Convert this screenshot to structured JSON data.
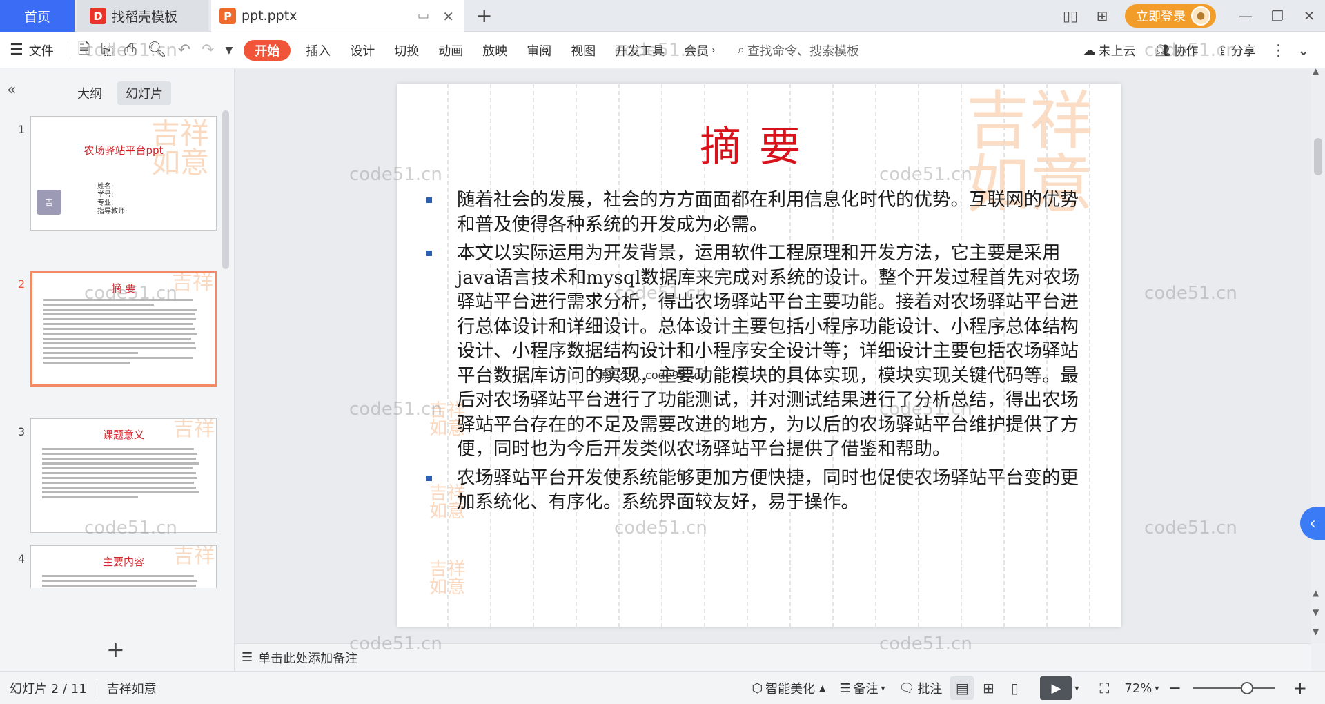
{
  "titlebar": {
    "home_tab": "首页",
    "template_tab": "找稻壳模板",
    "file_tab": "ppt.pptx",
    "login_button": "立即登录"
  },
  "ribbon": {
    "file_menu": "文件",
    "tabs": [
      "开始",
      "插入",
      "设计",
      "切换",
      "动画",
      "放映",
      "审阅",
      "视图",
      "开发工具",
      "会员"
    ],
    "search_placeholder": "查找命令、搜索模板",
    "cloud_status": "未上云",
    "collab": "协作",
    "share": "分享"
  },
  "left_panel": {
    "tab_outline": "大纲",
    "tab_slides": "幻灯片",
    "thumbs": [
      {
        "num": "1",
        "title": "农场驿站平台ppt",
        "fields": [
          "姓名:",
          "学号:",
          "专业:",
          "指导教师:"
        ]
      },
      {
        "num": "2",
        "title": "摘  要"
      },
      {
        "num": "3",
        "title": "课题意义"
      },
      {
        "num": "4",
        "title": "主要内容"
      }
    ]
  },
  "slide": {
    "title": "摘要",
    "bullets": [
      "  随着社会的发展，社会的方方面面都在利用信息化时代的优势。互联网的优势和普及使得各种系统的开发成为必需。",
      "本文以实际运用为开发背景，运用软件工程原理和开发方法，它主要是采用java语言技术和mysql数据库来完成对系统的设计。整个开发过程首先对农场驿站平台进行需求分析，得出农场驿站平台主要功能。接着对农场驿站平台进行总体设计和详细设计。总体设计主要包括小程序功能设计、小程序总体结构设计、小程序数据结构设计和小程序安全设计等；详细设计主要包括农场驿站平台数据库访问的实现，主要功能模块的具体实现，模块实现关键代码等。最后对农场驿站平台进行了功能测试，并对测试结果进行了分析总结，得出农场驿站平台存在的不足及需要改进的地方，为以后的农场驿站平台维护提供了方便，同时也为今后开发类似农场驿站平台提供了借鉴和帮助。",
      "农场驿站平台开发使系统能够更加方便快捷，同时也促使农场驿站平台变的更加系统化、有序化。系统界面较友好，易于操作。"
    ],
    "overlay": "源码久久 code99.top",
    "stamp_text": "吉祥如意"
  },
  "notes": {
    "placeholder": "单击此处添加备注"
  },
  "statusbar": {
    "slide_counter": "幻灯片 2 / 11",
    "theme": "吉祥如意",
    "beautify": "智能美化",
    "notes": "备注",
    "comments": "批注",
    "zoom": "72%"
  },
  "watermark": "code51.cn",
  "colors": {
    "accent": "#3b6cf6",
    "active_tab": "#f0553a",
    "title_red": "#d8121b",
    "login": "#f29d2a"
  }
}
